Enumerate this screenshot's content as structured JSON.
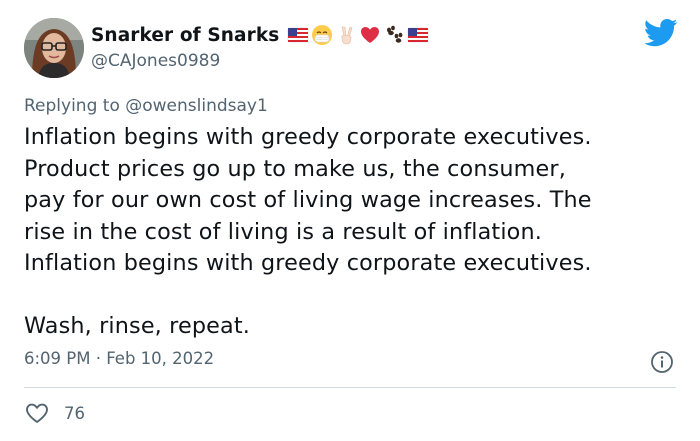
{
  "user": {
    "display_name": "Snarker of Snarks",
    "handle": "@CAJones0989",
    "name_emojis": [
      "us-flag-icon",
      "mask-face-icon",
      "victory-hand-icon",
      "red-heart-icon",
      "paw-prints-icon",
      "us-flag-icon"
    ]
  },
  "reply": {
    "prefix": "Replying to",
    "mention": "@owenslindsay1"
  },
  "tweet": {
    "text": "Inflation begins with greedy corporate executives.\nProduct prices go up to make us, the consumer,\npay for our own cost of living wage increases.  The\nrise in the cost of living is a result of inflation.\nInflation begins with greedy corporate executives.\n\nWash, rinse, repeat.",
    "timestamp": "6:09 PM · Feb 10, 2022"
  },
  "engagement": {
    "likes": "76"
  },
  "colors": {
    "twitter_blue": "#1d9bf0",
    "secondary_text": "#536471",
    "primary_text": "#0f1419",
    "divider": "#cfd9de"
  }
}
